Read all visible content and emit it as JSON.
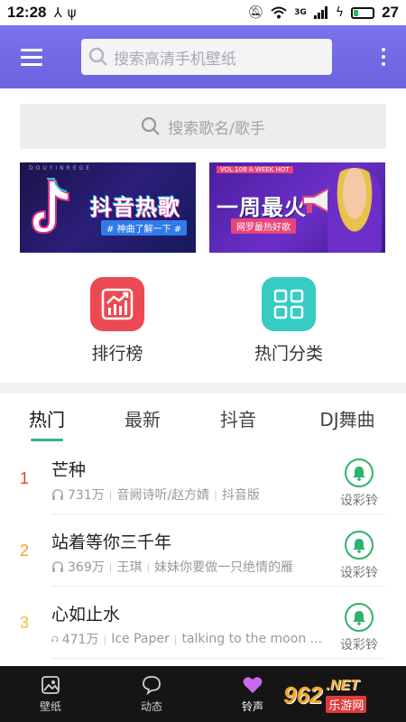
{
  "status_bar": {
    "time": "12:28",
    "battery": "27",
    "battery_level": 0.27,
    "network": "3G"
  },
  "app_bar": {
    "search_placeholder": "搜索高清手机壁纸"
  },
  "song_search": {
    "placeholder": "搜索歌名/歌手"
  },
  "banners": [
    {
      "title": "抖音热歌",
      "subtitle": "# 神曲了解一下 #",
      "tiny": "DOUYINREGE"
    },
    {
      "title": "一周最火",
      "subtitle": "网罗最热好歌",
      "tag": "VOL.108 A WEEK HOT"
    }
  ],
  "features": [
    {
      "label": "排行榜",
      "icon": "chart-icon"
    },
    {
      "label": "热门分类",
      "icon": "grid-icon"
    }
  ],
  "tabs": [
    {
      "label": "热门",
      "active": true
    },
    {
      "label": "最新",
      "active": false
    },
    {
      "label": "抖音",
      "active": false
    },
    {
      "label": "DJ舞曲",
      "active": false
    }
  ],
  "songs": [
    {
      "rank": "1",
      "rank_color": "#e0413a",
      "title": "芒种",
      "plays": "731万",
      "artist": "音阙诗听/赵方婧",
      "note": "抖音版",
      "action": "设彩铃"
    },
    {
      "rank": "2",
      "rank_color": "#f0a020",
      "title": "站着等你三千年",
      "plays": "369万",
      "artist": "王琪",
      "note": "妹妹你要做一只绝情的雁",
      "action": "设彩铃"
    },
    {
      "rank": "3",
      "rank_color": "#f0c020",
      "title": "心如止水",
      "plays": "471万",
      "artist": "Ice Paper",
      "note": "talking to the moon ...",
      "action": "设彩铃"
    }
  ],
  "bottom_nav": [
    {
      "label": "壁纸",
      "icon": "image-icon",
      "active": false
    },
    {
      "label": "动态",
      "icon": "bubble-icon",
      "active": false
    },
    {
      "label": "铃声",
      "icon": "heart-icon",
      "active": true
    }
  ],
  "watermark": {
    "brand": "962",
    "domain": ".NET",
    "sub": "乐游网"
  },
  "colors": {
    "app_bar": "#6f67e4",
    "accent_green": "#2db38f",
    "bell_green": "#2db36b",
    "nav_bg": "#151515"
  }
}
